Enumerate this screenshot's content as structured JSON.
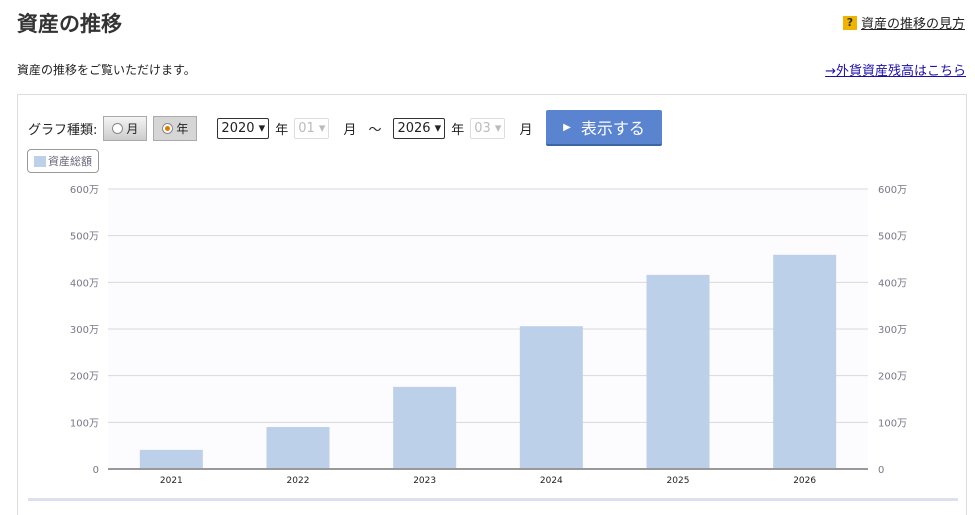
{
  "header": {
    "title": "資産の推移",
    "help_link": "資産の推移の見方",
    "description": "資産の推移をご覧いただけます。",
    "foreign_link": "→外貨資産残高はこちら"
  },
  "controls": {
    "graph_type_label": "グラフ種類:",
    "month_option": "月",
    "year_option": "年",
    "selected_type": "年",
    "from_year": "2020",
    "year_unit": "年",
    "from_month": "01",
    "month_unit": "月",
    "tilde": "〜",
    "to_year": "2026",
    "to_month": "03",
    "show_button": "表示する"
  },
  "chart_data": {
    "type": "bar",
    "categories": [
      "2021",
      "2022",
      "2023",
      "2024",
      "2025",
      "2026"
    ],
    "series": [
      {
        "name": "資産総額",
        "values": [
          41,
          90,
          176,
          306,
          416,
          459
        ],
        "color": "#bdd0ea"
      }
    ],
    "ylim": [
      0,
      600
    ],
    "yticks": [
      "0",
      "100万",
      "200万",
      "300万",
      "400万",
      "500万",
      "600万"
    ],
    "unit": "万",
    "grid": true,
    "legend": "top-left"
  }
}
